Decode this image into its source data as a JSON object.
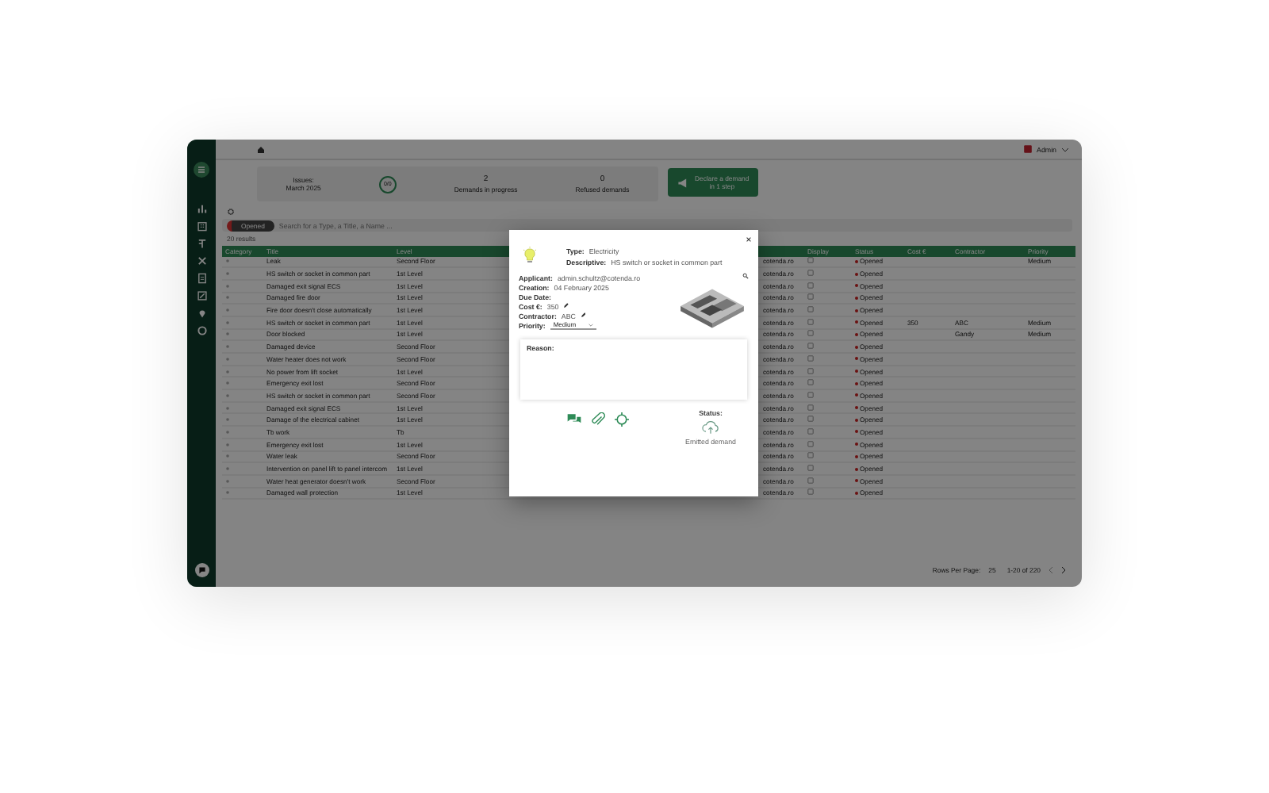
{
  "topbar": {
    "user": "Admin"
  },
  "stats": [
    {
      "kind": "text",
      "label": "Issues:",
      "value": "March 2025"
    },
    {
      "kind": "ring",
      "value": "0/0"
    },
    {
      "kind": "count",
      "value": "2",
      "label": "Demands in progress"
    },
    {
      "kind": "count",
      "value": "0",
      "label": "Refused demands"
    }
  ],
  "create_button": {
    "line1": "Declare a demand",
    "line2": "in 1 step"
  },
  "search": {
    "chip": "Opened",
    "placeholder": "Search for a Type, a Title, a Name ..."
  },
  "results": "20 results",
  "table": {
    "columns": [
      "Category",
      "Title",
      "Level",
      "Display",
      "Status",
      "Cost €",
      "Contractor",
      "Priority"
    ],
    "rows": [
      {
        "title": "Leak",
        "level": "Second Floor",
        "applicant": "cotenda.ro",
        "status": "Opened",
        "cost": "",
        "contractor": "",
        "priority": "Medium"
      },
      {
        "title": "HS switch or socket in common part",
        "level": "1st Level",
        "applicant": "cotenda.ro",
        "status": "Opened",
        "cost": "",
        "contractor": "",
        "priority": ""
      },
      {
        "title": "Damaged exit signal ECS",
        "level": "1st Level",
        "applicant": "cotenda.ro",
        "status": "Opened",
        "cost": "",
        "contractor": "",
        "priority": ""
      },
      {
        "title": "Damaged fire door",
        "level": "1st Level",
        "applicant": "cotenda.ro",
        "status": "Opened",
        "cost": "",
        "contractor": "",
        "priority": ""
      },
      {
        "title": "Fire door doesn't close automatically",
        "level": "1st Level",
        "applicant": "cotenda.ro",
        "status": "Opened",
        "cost": "",
        "contractor": "",
        "priority": ""
      },
      {
        "title": "HS switch or socket in common part",
        "level": "1st Level",
        "applicant": "cotenda.ro",
        "status": "Opened",
        "cost": "350",
        "contractor": "ABC",
        "priority": "Medium"
      },
      {
        "title": "Door blocked",
        "level": "1st Level",
        "applicant": "cotenda.ro",
        "status": "Opened",
        "cost": "",
        "contractor": "Gandy",
        "priority": "Medium"
      },
      {
        "title": "Damaged device",
        "level": "Second Floor",
        "applicant": "cotenda.ro",
        "status": "Opened",
        "cost": "",
        "contractor": "",
        "priority": ""
      },
      {
        "title": "Water heater does not work",
        "level": "Second Floor",
        "applicant": "cotenda.ro",
        "status": "Opened",
        "cost": "",
        "contractor": "",
        "priority": ""
      },
      {
        "title": "No power from lift socket",
        "level": "1st Level",
        "applicant": "cotenda.ro",
        "status": "Opened",
        "cost": "",
        "contractor": "",
        "priority": ""
      },
      {
        "title": "Emergency exit lost",
        "level": "Second Floor",
        "applicant": "cotenda.ro",
        "status": "Opened",
        "cost": "",
        "contractor": "",
        "priority": ""
      },
      {
        "title": "HS switch or socket in common part",
        "level": "Second Floor",
        "applicant": "cotenda.ro",
        "status": "Opened",
        "cost": "",
        "contractor": "",
        "priority": ""
      },
      {
        "title": "Damaged exit signal ECS",
        "level": "1st Level",
        "applicant": "cotenda.ro",
        "status": "Opened",
        "cost": "",
        "contractor": "",
        "priority": ""
      },
      {
        "title": "Damage of the electrical cabinet",
        "level": "1st Level",
        "applicant": "cotenda.ro",
        "status": "Opened",
        "cost": "",
        "contractor": "",
        "priority": ""
      },
      {
        "title": "Tb work",
        "level": "Tb",
        "applicant": "cotenda.ro",
        "status": "Opened",
        "cost": "",
        "contractor": "",
        "priority": ""
      },
      {
        "title": "Emergency exit lost",
        "level": "1st Level",
        "applicant": "cotenda.ro",
        "status": "Opened",
        "cost": "",
        "contractor": "",
        "priority": ""
      },
      {
        "title": "Water leak",
        "level": "Second Floor",
        "applicant": "cotenda.ro",
        "status": "Opened",
        "cost": "",
        "contractor": "",
        "priority": ""
      },
      {
        "title": "Intervention on panel lift to panel intercom",
        "level": "1st Level",
        "applicant": "cotenda.ro",
        "status": "Opened",
        "cost": "",
        "contractor": "",
        "priority": ""
      },
      {
        "title": "Water heat generator doesn't work",
        "level": "Second Floor",
        "applicant": "cotenda.ro",
        "status": "Opened",
        "cost": "",
        "contractor": "",
        "priority": ""
      },
      {
        "title": "Damaged wall protection",
        "level": "1st Level",
        "applicant": "cotenda.ro",
        "status": "Opened",
        "cost": "",
        "contractor": "",
        "priority": ""
      }
    ]
  },
  "pagination": {
    "label": "Rows Per Page:",
    "per_page": "25",
    "range": "1-20 of 220"
  },
  "modal": {
    "type_label": "Type:",
    "type": "Electricity",
    "desc_label": "Descriptive:",
    "desc": "HS switch or socket in common part",
    "fields": [
      {
        "label": "Applicant:",
        "value": "admin.schultz@cotenda.ro",
        "editable": false
      },
      {
        "label": "Creation:",
        "value": "04 February 2025",
        "editable": false
      },
      {
        "label": "Due Date:",
        "editable": false
      },
      {
        "label": "Cost €:",
        "value": "350",
        "editable": true
      },
      {
        "label": "Contractor:",
        "value": "ABC",
        "editable": true
      }
    ],
    "priority_label": "Priority:",
    "priority": "Medium",
    "reason_label": "Reason:",
    "status_label": "Status:",
    "status": "Emitted demand"
  }
}
